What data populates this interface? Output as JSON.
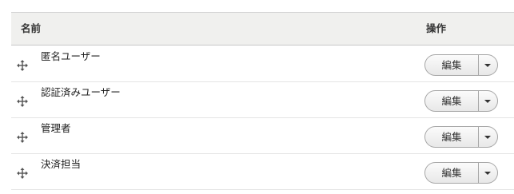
{
  "table": {
    "headers": {
      "name": "名前",
      "operations": "操作"
    },
    "rows": [
      {
        "label": "匿名ユーザー",
        "edit_label": "編集"
      },
      {
        "label": "認証済みユーザー",
        "edit_label": "編集"
      },
      {
        "label": "管理者",
        "edit_label": "編集"
      },
      {
        "label": "決済担当",
        "edit_label": "編集"
      }
    ]
  },
  "icons": {
    "drag": "drag-handle-icon",
    "dropdown": "chevron-down-icon"
  },
  "colors": {
    "header_bg": "#f0f0ee",
    "border": "#d4d4d4",
    "button_border": "#a6a6a6"
  }
}
